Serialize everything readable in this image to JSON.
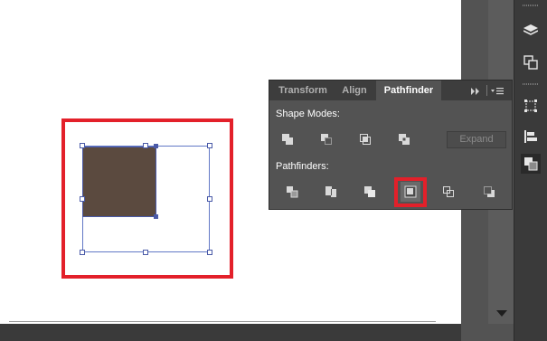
{
  "panel": {
    "tabs": [
      "Transform",
      "Align",
      "Pathfinder"
    ],
    "active_tab": "Pathfinder",
    "shape_modes_label": "Shape Modes:",
    "pathfinders_label": "Pathfinders:",
    "expand_label": "Expand",
    "shape_mode_buttons": [
      "unite-icon",
      "minus-front-icon",
      "intersect-icon",
      "exclude-icon"
    ],
    "pathfinder_buttons": [
      "divide-icon",
      "trim-icon",
      "merge-icon",
      "crop-icon",
      "outline-icon",
      "minus-back-icon"
    ],
    "highlighted_button": "crop-icon"
  },
  "canvas": {
    "shape_fill_color": "#5b4a3f",
    "selection_color": "#4a5aa8",
    "highlight_color": "#e3202a"
  },
  "dock": {
    "icons": [
      "layers-icon",
      "artboards-icon",
      "transform-icon",
      "align-icon",
      "pathfinder-icon"
    ],
    "active_icon": "pathfinder-icon"
  }
}
